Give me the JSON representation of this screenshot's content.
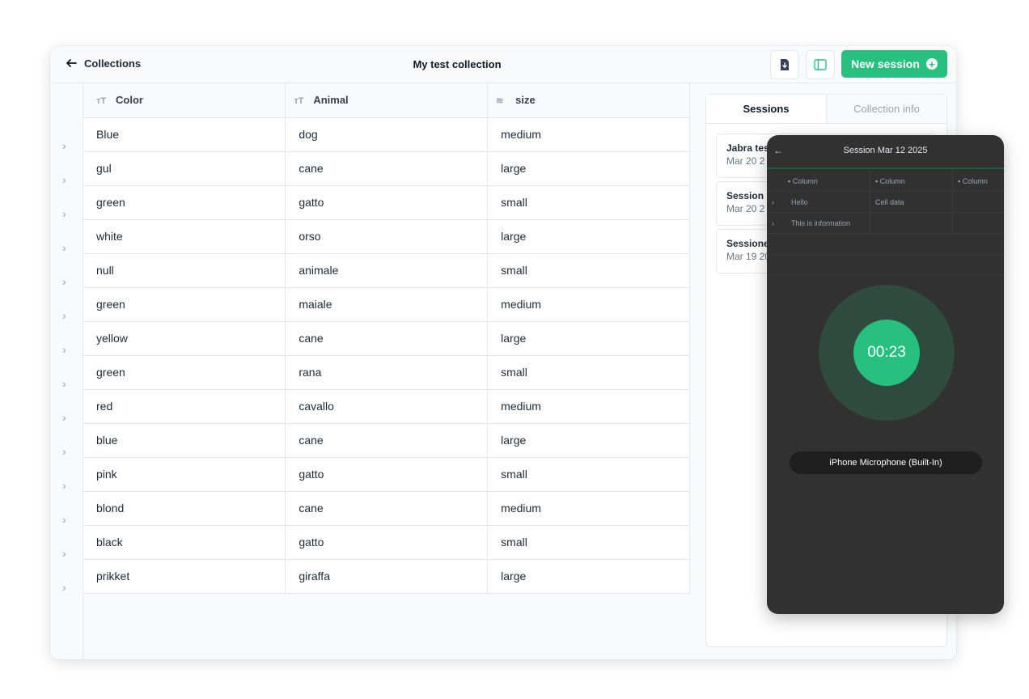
{
  "header": {
    "back_label": "Collections",
    "title": "My test collection",
    "new_session_label": "New session"
  },
  "table": {
    "columns": [
      {
        "label": "Color",
        "icon": "text-icon"
      },
      {
        "label": "Animal",
        "icon": "text-icon"
      },
      {
        "label": "size",
        "icon": "database-icon"
      }
    ],
    "rows": [
      [
        "Blue",
        "dog",
        "medium"
      ],
      [
        "gul",
        "cane",
        "large"
      ],
      [
        "green",
        "gatto",
        "small"
      ],
      [
        "white",
        "orso",
        "large"
      ],
      [
        "null",
        "animale",
        "small"
      ],
      [
        "green",
        "maiale",
        "medium"
      ],
      [
        "yellow",
        "cane",
        "large"
      ],
      [
        "green",
        "rana",
        "small"
      ],
      [
        "red",
        "cavallo",
        "medium"
      ],
      [
        "blue",
        "cane",
        "large"
      ],
      [
        "pink",
        "gatto",
        "small"
      ],
      [
        "blond",
        "cane",
        "medium"
      ],
      [
        "black",
        "gatto",
        "small"
      ],
      [
        "prikket",
        "giraffa",
        "large"
      ]
    ]
  },
  "panel": {
    "tabs": [
      "Sessions",
      "Collection info"
    ],
    "sessions": [
      {
        "name": "Jabra tes",
        "date": "Mar 20 2"
      },
      {
        "name": "Session I",
        "date": "Mar 20 2"
      },
      {
        "name": "Sessione",
        "date": "Mar 19 20"
      }
    ]
  },
  "phone": {
    "title": "Session Mar 12 2025",
    "columns": [
      "Column",
      "Column",
      "Column"
    ],
    "rows": [
      [
        "Hello",
        "Cell data"
      ],
      [
        "This is information",
        ""
      ]
    ],
    "timer": "00:23",
    "microphone": "iPhone Microphone (Built-In)"
  },
  "colors": {
    "accent": "#27c07e",
    "phone_bg": "#313131"
  }
}
